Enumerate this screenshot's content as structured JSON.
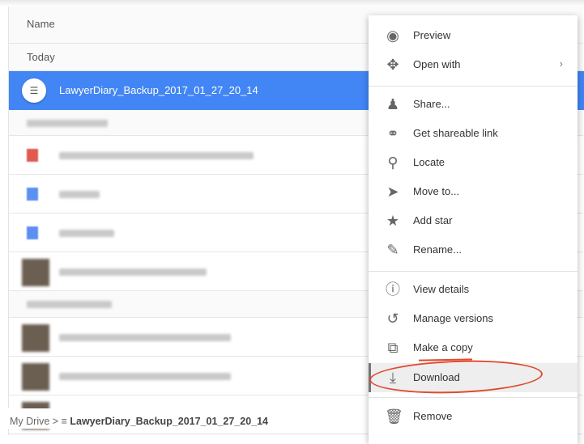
{
  "list": {
    "column_header": "Name",
    "section_today": "Today",
    "selected_file": "LawyerDiary_Backup_2017_01_27_20_14",
    "selected_color": "#4285f4"
  },
  "breadcrumb": {
    "root": "My Drive",
    "separator": ">",
    "current": "LawyerDiary_Backup_2017_01_27_20_14"
  },
  "menu": {
    "items": [
      {
        "label": "Preview",
        "icon": "eye-icon"
      },
      {
        "label": "Open with",
        "icon": "move-arrows-icon"
      },
      {
        "label": "Share...",
        "icon": "person-add-icon"
      },
      {
        "label": "Get shareable link",
        "icon": "link-icon"
      },
      {
        "label": "Locate",
        "icon": "search-icon"
      },
      {
        "label": "Move to...",
        "icon": "folder-move-icon"
      },
      {
        "label": "Add star",
        "icon": "star-icon"
      },
      {
        "label": "Rename...",
        "icon": "pencil-icon"
      },
      {
        "label": "View details",
        "icon": "info-icon"
      },
      {
        "label": "Manage versions",
        "icon": "history-icon"
      },
      {
        "label": "Make a copy",
        "icon": "copy-icon"
      },
      {
        "label": "Download",
        "icon": "download-icon"
      },
      {
        "label": "Remove",
        "icon": "trash-icon"
      }
    ]
  },
  "annotation_color": "#e04a2e"
}
